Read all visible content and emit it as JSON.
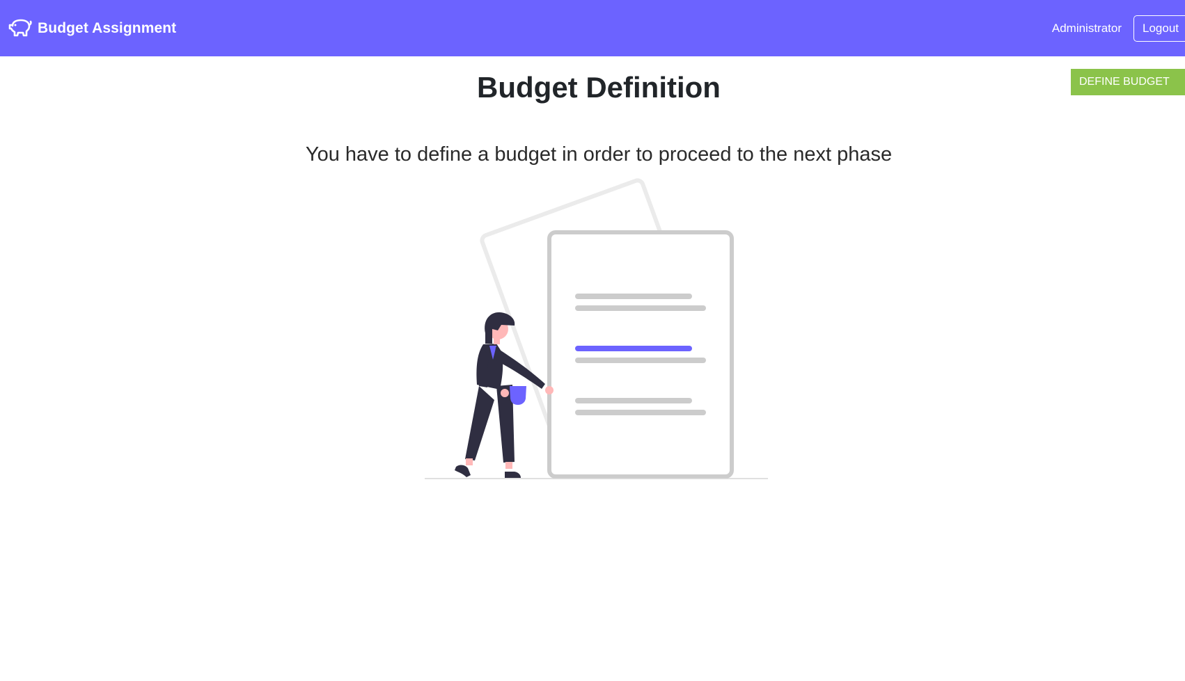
{
  "colors": {
    "navbar_bg": "#6c63ff",
    "define_button_bg": "#8bc34a",
    "illustration_accent": "#6c63ff",
    "illustration_dark": "#2f2e41",
    "illustration_gray": "#cccccc",
    "illustration_light_gray": "#e6e6e6",
    "skin": "#ffb8b8"
  },
  "navbar": {
    "brand_icon": "piggy-bank-icon",
    "brand_title": "Budget Assignment",
    "user_name": "Administrator",
    "logout_label": "Logout"
  },
  "main": {
    "title": "Budget Definition",
    "define_button_label": "DEFINE BUDGET",
    "message": "You have to define a budget in order to proceed to the next phase",
    "illustration": "empty-document-illustration"
  }
}
